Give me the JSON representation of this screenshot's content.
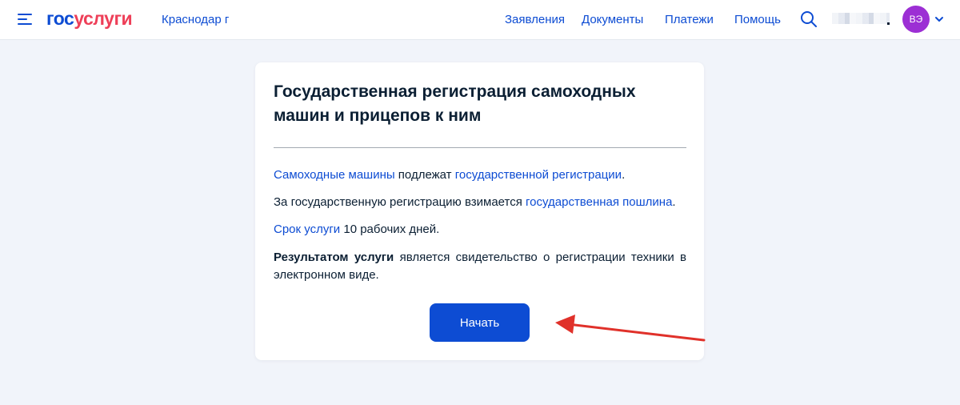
{
  "header": {
    "logo_part1": "гос",
    "logo_part2": "услуги",
    "region": "Краснодар г",
    "nav": [
      "Заявления",
      "Документы",
      "Платежи",
      "Помощь"
    ],
    "avatar_initials": "ВЭ",
    "icons": {
      "menu": "burger-menu-icon",
      "search": "search-icon",
      "dropdown": "chevron-down-icon"
    }
  },
  "card": {
    "title": "Государственная регистрация самоходных машин и прицепов к ним",
    "p1": {
      "link1": "Самоходные машины",
      "text1": " подлежат ",
      "link2": "государственной регистрации",
      "text2": "."
    },
    "p2": {
      "text1": "За государственную регистрацию взимается ",
      "link1": "государственная пошлина",
      "text2": "."
    },
    "p3": {
      "link1": "Срок услуги",
      "text1": " 10 рабочих дней."
    },
    "p4": {
      "bold": "Результатом услуги",
      "text1": " является свидетельство о регистрации техники в электронном виде."
    },
    "start_button": "Начать"
  },
  "colors": {
    "brand_blue": "#0d4cd3",
    "brand_red": "#ee3f58",
    "avatar_purple": "#9c2fd4",
    "background": "#f1f4fa",
    "annotation_arrow": "#e0312a"
  }
}
